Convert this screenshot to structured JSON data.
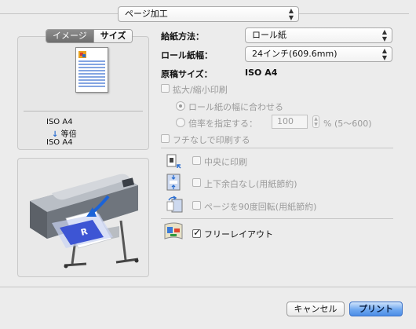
{
  "header": {
    "panel_select": {
      "value": "ページ加工"
    }
  },
  "preview": {
    "tabs": [
      "イメージ",
      "サイズ"
    ],
    "active_tab": 0,
    "orig_size": "ISO A4",
    "ratio_label": "等倍",
    "output_size": "ISO A4"
  },
  "settings": {
    "feed_label": "給紙方法：",
    "feed_value": "ロール紙",
    "roll_width_label": "ロール紙幅：",
    "roll_width_value": "24インチ(609.6mm)",
    "doc_size_label": "原稿サイズ：",
    "doc_size_value": "ISO A4"
  },
  "scaling": {
    "enlarge_reduce": {
      "label": "拡大/縮小印刷",
      "checked": false,
      "enabled": false
    },
    "fit_roll": {
      "label": "ロール紙の幅に合わせる",
      "selected": true,
      "enabled": false
    },
    "specify_ratio": {
      "label": "倍率を指定する：",
      "selected": false,
      "enabled": false
    },
    "ratio_value": "100",
    "ratio_unit": "% (5〜600)",
    "borderless": {
      "label": "フチなしで印刷する",
      "checked": false,
      "enabled": false
    }
  },
  "layout": {
    "center": {
      "label": "中央に印刷",
      "checked": false,
      "enabled": false
    },
    "no_margin": {
      "label": "上下余白なし(用紙節約)",
      "checked": false,
      "enabled": false
    },
    "rotate90": {
      "label": "ページを90度回転(用紙節約)",
      "checked": false,
      "enabled": false
    },
    "free_layout": {
      "label": "フリーレイアウト",
      "checked": true,
      "enabled": true
    }
  },
  "footer": {
    "cancel_label": "キャンセル",
    "print_label": "プリント"
  },
  "colors": {
    "accent": "#4c8de6",
    "window_bg": "#ececec"
  }
}
